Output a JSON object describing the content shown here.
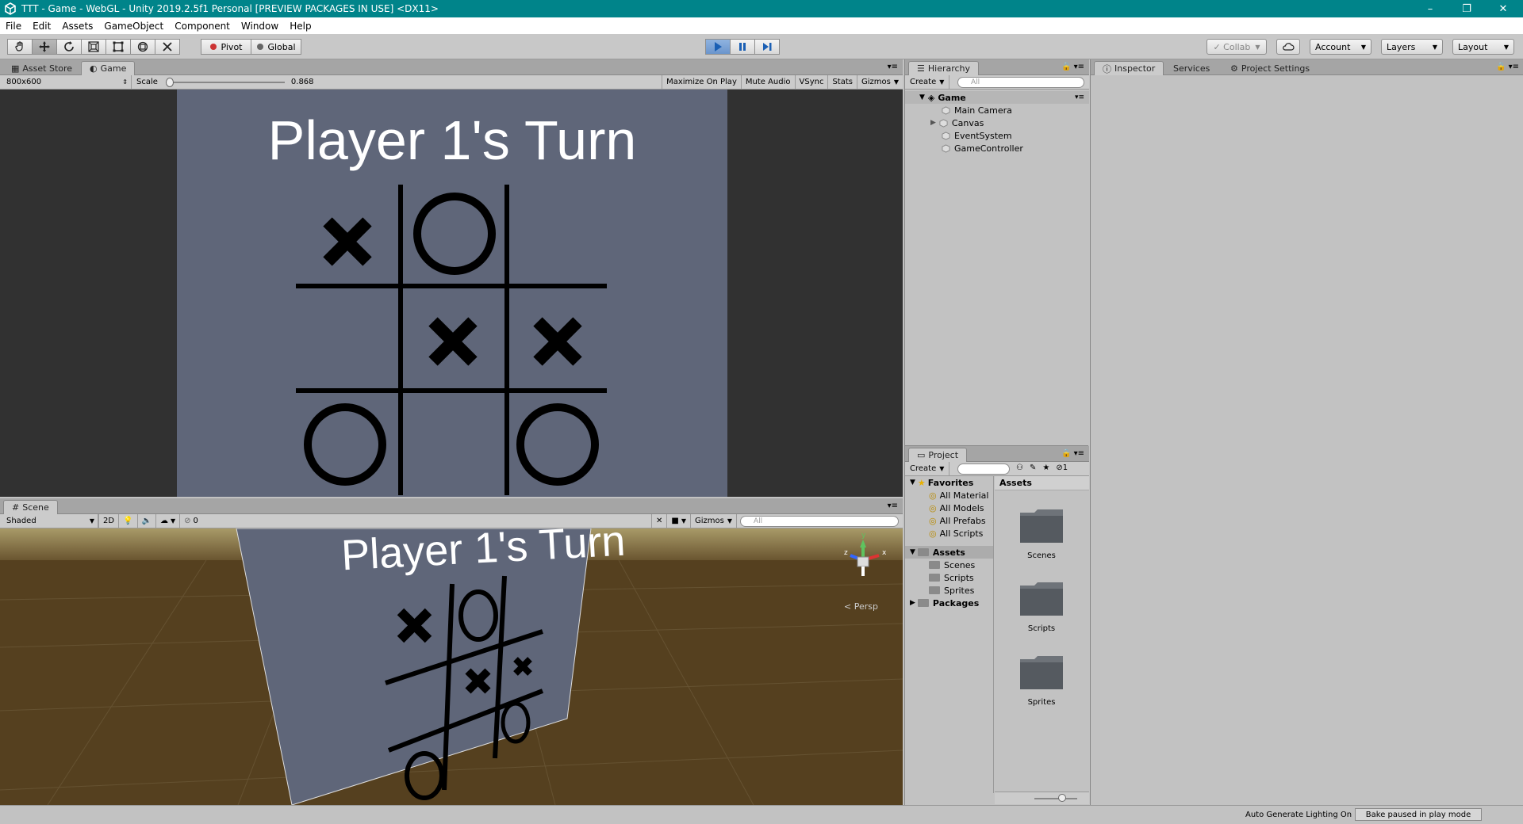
{
  "window": {
    "title": "TTT - Game - WebGL - Unity 2019.2.5f1 Personal [PREVIEW PACKAGES IN USE] <DX11>",
    "controls": [
      "–",
      "❐",
      "✕"
    ]
  },
  "menu": [
    "File",
    "Edit",
    "Assets",
    "GameObject",
    "Component",
    "Window",
    "Help"
  ],
  "toolbar": {
    "tools": [
      "hand-tool",
      "move-tool",
      "rotate-tool",
      "scale-tool",
      "rect-tool",
      "transform-tool",
      "custom-tool"
    ],
    "pivot_label": "Pivot",
    "global_label": "Global",
    "collab_label": "Collab",
    "account_label": "Account",
    "layers_label": "Layers",
    "layout_label": "Layout"
  },
  "game_panel": {
    "tabs": [
      "Asset Store",
      "Game"
    ],
    "resolution": "800x600",
    "scale_label": "Scale",
    "scale_value": "0.868",
    "toggles": [
      "Maximize On Play",
      "Mute Audio",
      "VSync",
      "Stats",
      "Gizmos"
    ],
    "turn_text": "Player 1's Turn",
    "board": [
      "X",
      "O",
      "",
      "",
      "X",
      "X",
      "O",
      "",
      "O"
    ]
  },
  "scene_panel": {
    "tab": "Scene",
    "shading": "Shaded",
    "mode_2d": "2D",
    "hidden_count": "0",
    "gizmos_label": "Gizmos",
    "search_placeholder": "All",
    "persp_label": "< Persp",
    "gizmo_axes": {
      "y": "y",
      "x": "x",
      "z": "z"
    }
  },
  "hierarchy": {
    "tab": "Hierarchy",
    "create_label": "Create",
    "search_placeholder": "All",
    "scene_name": "Game",
    "items": [
      "Main Camera",
      "Canvas",
      "EventSystem",
      "GameController"
    ]
  },
  "project": {
    "tab": "Project",
    "create_label": "Create",
    "hidden_count": "1",
    "favorites_label": "Favorites",
    "favorites": [
      "All Material",
      "All Models",
      "All Prefabs",
      "All Scripts"
    ],
    "assets_label": "Assets",
    "asset_folders": [
      "Scenes",
      "Scripts",
      "Sprites"
    ],
    "packages_label": "Packages",
    "breadcrumb": "Assets",
    "grid_items": [
      "Scenes",
      "Scripts",
      "Sprites"
    ]
  },
  "inspector": {
    "tabs": [
      "Inspector",
      "Services",
      "Project Settings"
    ]
  },
  "status_bar": {
    "lighting": "Auto Generate Lighting On",
    "bake": "Bake paused in play mode"
  },
  "colors": {
    "titlebar": "#00848a",
    "game_bg": "#5f6679",
    "play_active": "#6b95cc"
  }
}
